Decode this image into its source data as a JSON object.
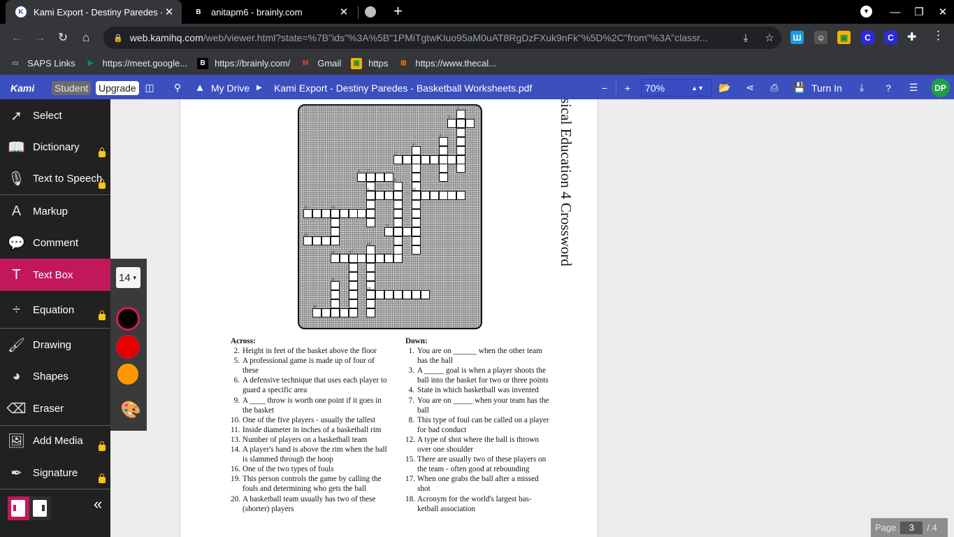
{
  "browser": {
    "tabs": [
      {
        "title": "Kami Export - Destiny Paredes - E",
        "favicon": "K",
        "active": true
      },
      {
        "title": "anitapm6 - brainly.com",
        "favicon": "B",
        "active": false
      }
    ],
    "new_tab_label": "+",
    "url_host": "web.kamihq.com",
    "url_rest": "/web/viewer.html?state=%7B\"ids\"%3A%5B\"1PMiTgtwKIuo95aM0uAT8RgDzFXuk9nFk\"%5D%2C\"from\"%3A\"classr...",
    "extensions": [
      {
        "name": "extension-w",
        "label": "Ш",
        "color": "#1a9ae0"
      },
      {
        "name": "extension-mascot",
        "label": "☺",
        "color": "#555555"
      },
      {
        "name": "google-classroom",
        "label": "▣",
        "color": "#f4b400"
      },
      {
        "name": "extension-c1",
        "label": "C",
        "color": "#2b2bd9"
      },
      {
        "name": "extension-c2",
        "label": "C",
        "color": "#2b2bd9"
      }
    ],
    "bookmarks": [
      {
        "label": "SAPS Links",
        "icon": "folder-icon",
        "glyph": "▭",
        "color": "#9aa0a6"
      },
      {
        "label": "https://meet.google...",
        "icon": "meet-icon",
        "glyph": "▶",
        "color": "#00897b"
      },
      {
        "label": "https://brainly.com/",
        "icon": "brainly-icon",
        "glyph": "B",
        "color": "#000000"
      },
      {
        "label": "Gmail",
        "icon": "gmail-icon",
        "glyph": "M",
        "color": "#ea4335"
      },
      {
        "label": "https",
        "icon": "classroom-icon",
        "glyph": "▣",
        "color": "#f4b400"
      },
      {
        "label": "https://www.thecal...",
        "icon": "calculator-icon",
        "glyph": "⊞",
        "color": "#f57c00"
      }
    ]
  },
  "kami": {
    "logo": "Kami",
    "plan_badge": "Student",
    "upgrade_label": "Upgrade",
    "drive_label": "My Drive",
    "doc_title": "Kami Export - Destiny Paredes - Basketball Worksheets.pdf",
    "zoom_level": "70%",
    "turn_in_label": "Turn In",
    "avatar_initials": "DP",
    "tools": [
      {
        "label": "Select",
        "icon": "cursor-icon",
        "glyph": "➚",
        "locked": false,
        "active": false
      },
      {
        "label": "Dictionary",
        "icon": "book-icon",
        "glyph": "📖",
        "locked": true,
        "active": false
      },
      {
        "label": "Text to Speech",
        "icon": "microphone-icon",
        "glyph": "🎙",
        "locked": true,
        "active": false
      },
      {
        "label": "Markup",
        "icon": "markup-icon",
        "glyph": "A",
        "locked": false,
        "active": false
      },
      {
        "label": "Comment",
        "icon": "comment-icon",
        "glyph": "💬",
        "locked": false,
        "active": false
      },
      {
        "label": "Text Box",
        "icon": "text-icon",
        "glyph": "T",
        "locked": false,
        "active": true
      },
      {
        "label": "Equation",
        "icon": "divide-icon",
        "glyph": "÷",
        "locked": true,
        "active": false
      },
      {
        "label": "Drawing",
        "icon": "brush-icon",
        "glyph": "🖌",
        "locked": false,
        "active": false
      },
      {
        "label": "Shapes",
        "icon": "shapes-icon",
        "glyph": "◕",
        "locked": false,
        "active": false
      },
      {
        "label": "Eraser",
        "icon": "eraser-icon",
        "glyph": "⌫",
        "locked": false,
        "active": false
      },
      {
        "label": "Add Media",
        "icon": "media-icon",
        "glyph": "🖼",
        "locked": true,
        "active": false
      },
      {
        "label": "Signature",
        "icon": "pen-nib-icon",
        "glyph": "✒",
        "locked": true,
        "active": false
      }
    ],
    "text_options": {
      "font_size": "14",
      "colors": [
        "#000000",
        "#e50000",
        "#ff9800"
      ],
      "selected_color": "#000000"
    },
    "page_indicator": {
      "label": "Page",
      "current": "3",
      "total": "/ 4"
    }
  },
  "document": {
    "vertical_title": "sical Education 4 Crossword",
    "across_heading": "Across:",
    "down_heading": "Down:",
    "across": [
      {
        "n": "2.",
        "text": "Height in feet of the basket above the floor"
      },
      {
        "n": "5.",
        "text": "A professional game is made up of four of these"
      },
      {
        "n": "6.",
        "text": "A defensive technique that uses each player to guard a specific area"
      },
      {
        "n": "9.",
        "text": "A ____ throw is worth one point if it goes in the basket"
      },
      {
        "n": "10.",
        "text": "One of the five players - usually the tallest"
      },
      {
        "n": "11.",
        "text": "Inside diameter in inches of a basketball rim"
      },
      {
        "n": "13.",
        "text": "Number of players on a basketball team"
      },
      {
        "n": "14.",
        "text": "A player's  hand is above the rim when the ball is slammed through the hoop"
      },
      {
        "n": "16.",
        "text": "One of the two types of fouls"
      },
      {
        "n": "19.",
        "text": "This person controls the game by calling the fouls and determining who gets the ball"
      },
      {
        "n": "20.",
        "text": "A basketball team usually has two of these (shorter) players"
      }
    ],
    "down": [
      {
        "n": "1.",
        "text": "You are on ______ when the other team has the ball"
      },
      {
        "n": "3.",
        "text": "A _____ goal is when a player shoots the ball into the basket for two or three points"
      },
      {
        "n": "4.",
        "text": "State in which basketball was invented"
      },
      {
        "n": "7.",
        "text": "You are on _____ when your team has the ball"
      },
      {
        "n": "8.",
        "text": "This type of foul can be called on a player for bad conduct"
      },
      {
        "n": "12.",
        "text": "A type of shot where the ball is thrown over one shoulder"
      },
      {
        "n": "15.",
        "text": "There are usually two of these players on the team - often good at rebounding"
      },
      {
        "n": "17.",
        "text": "When one grabs the ball after a missed shot"
      },
      {
        "n": "18.",
        "text": "Acronym for the world's largest bas-ketball association"
      }
    ],
    "crossword": {
      "entries": [
        {
          "n": 1,
          "dir": "down",
          "row": 0,
          "col": 17,
          "len": 7
        },
        {
          "n": 2,
          "dir": "across",
          "row": 1,
          "col": 16,
          "len": 3
        },
        {
          "n": 3,
          "dir": "down",
          "row": 3,
          "col": 15,
          "len": 5
        },
        {
          "n": 4,
          "dir": "down",
          "row": 4,
          "col": 12,
          "len": 12
        },
        {
          "n": 5,
          "dir": "across",
          "row": 5,
          "col": 10,
          "len": 8
        },
        {
          "n": 6,
          "dir": "across",
          "row": 7,
          "col": 6,
          "len": 4
        },
        {
          "n": 7,
          "dir": "down",
          "row": 7,
          "col": 7,
          "len": 6
        },
        {
          "n": 8,
          "dir": "down",
          "row": 8,
          "col": 10,
          "len": 8
        },
        {
          "n": 9,
          "dir": "across",
          "row": 9,
          "col": 7,
          "len": 4
        },
        {
          "n": 10,
          "dir": "across",
          "row": 9,
          "col": 12,
          "len": 6
        },
        {
          "n": 11,
          "dir": "across",
          "row": 11,
          "col": 0,
          "len": 8
        },
        {
          "n": 12,
          "dir": "down",
          "row": 11,
          "col": 3,
          "len": 4
        },
        {
          "n": 13,
          "dir": "across",
          "row": 13,
          "col": 9,
          "len": 4
        },
        {
          "n": 14,
          "dir": "across",
          "row": 14,
          "col": 0,
          "len": 4
        },
        {
          "n": 15,
          "dir": "down",
          "row": 15,
          "col": 7,
          "len": 8
        },
        {
          "n": 16,
          "dir": "across",
          "row": 16,
          "col": 3,
          "len": 8
        },
        {
          "n": 17,
          "dir": "down",
          "row": 16,
          "col": 5,
          "len": 7
        },
        {
          "n": 18,
          "dir": "down",
          "row": 19,
          "col": 3,
          "len": 3
        },
        {
          "n": 19,
          "dir": "across",
          "row": 20,
          "col": 7,
          "len": 7
        },
        {
          "n": 20,
          "dir": "across",
          "row": 22,
          "col": 1,
          "len": 5
        }
      ]
    }
  }
}
